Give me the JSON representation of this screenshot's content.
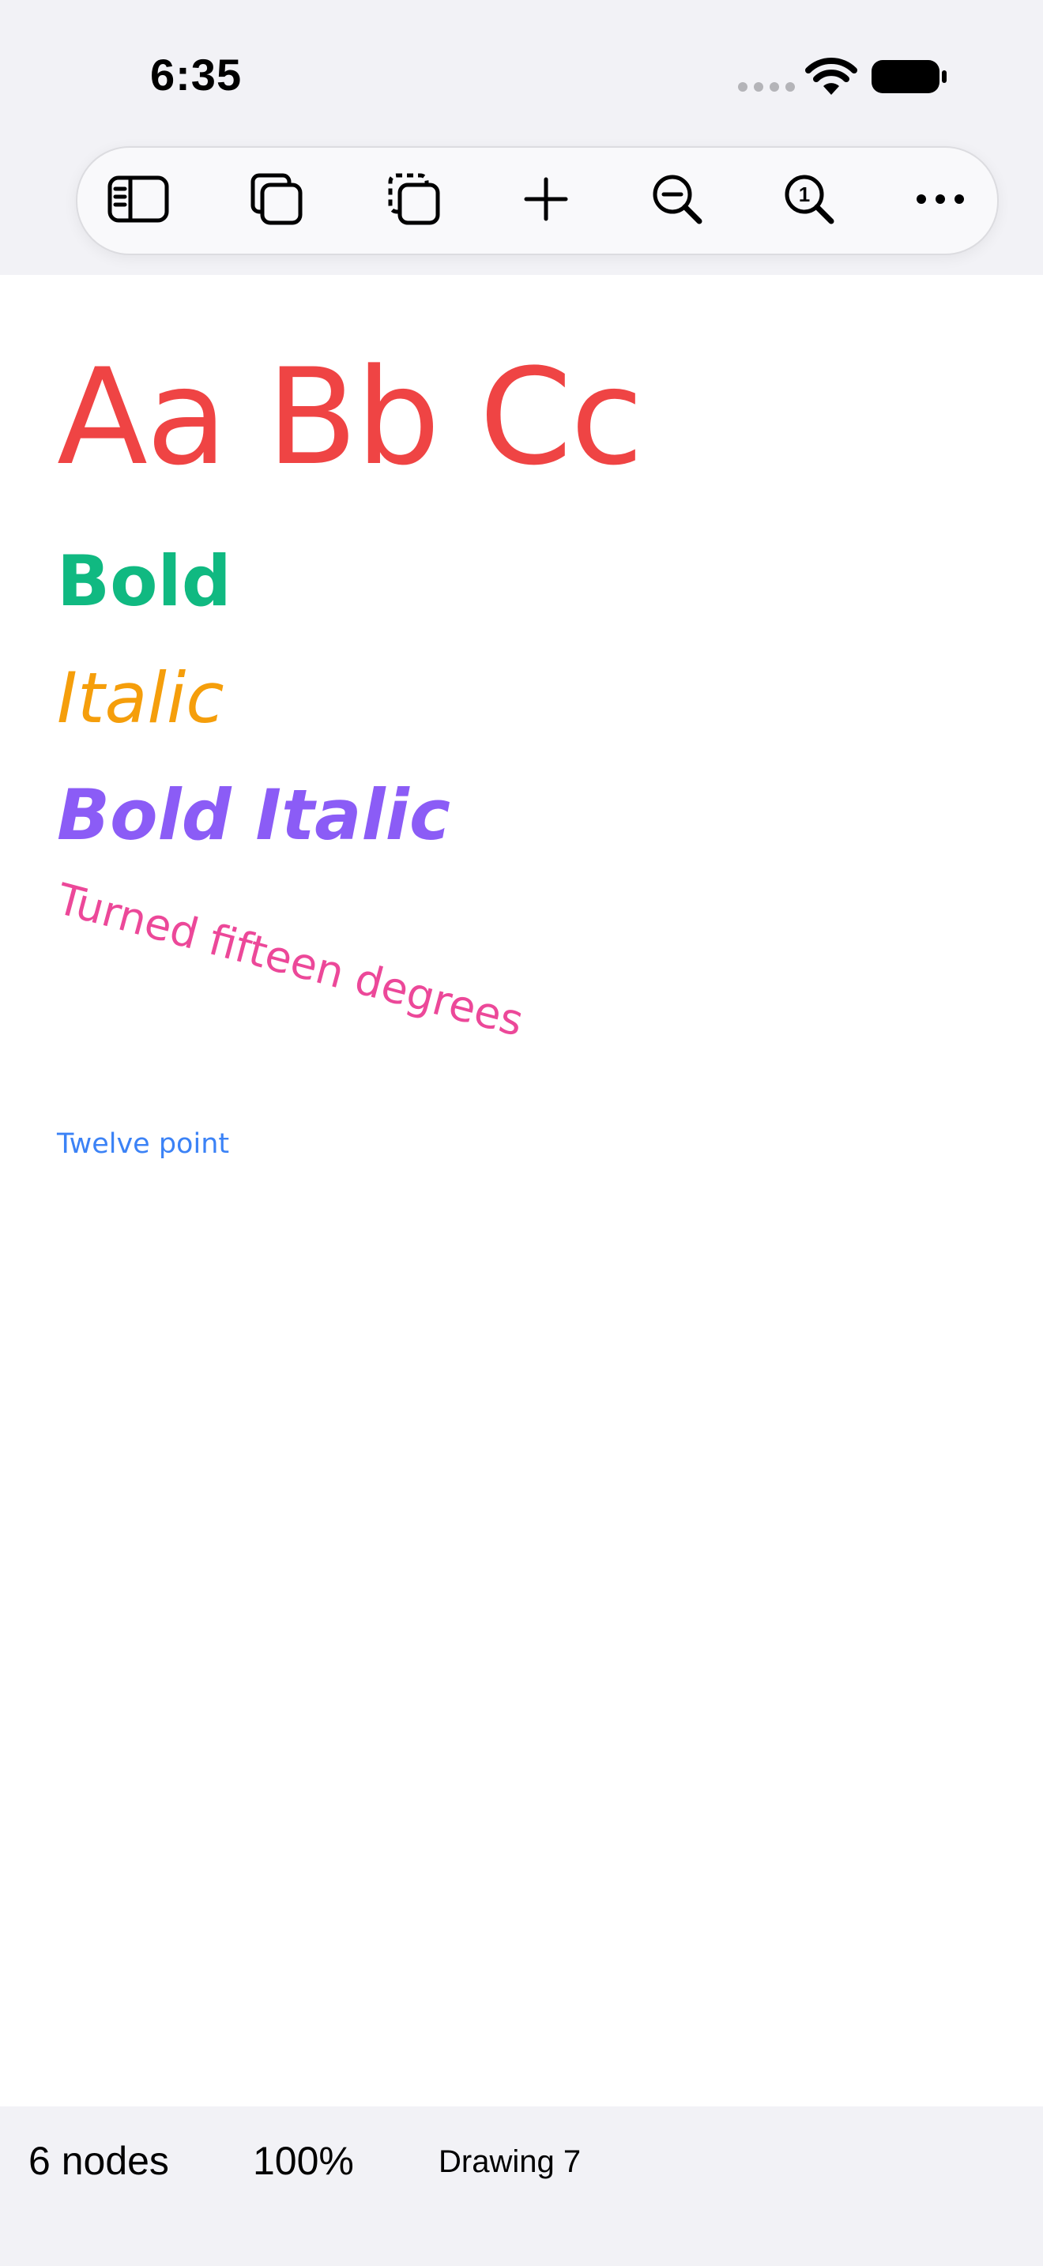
{
  "status_bar": {
    "time": "6:35",
    "icons": [
      "cellular-signal-icon",
      "wifi-icon",
      "battery-icon"
    ]
  },
  "toolbar": {
    "buttons": [
      {
        "name": "toggle-sidebar",
        "icon": "sidebar-icon"
      },
      {
        "name": "duplicate",
        "icon": "duplicate-icon"
      },
      {
        "name": "select-copy",
        "icon": "dashed-copy-icon"
      },
      {
        "name": "add",
        "icon": "plus-icon"
      },
      {
        "name": "zoom-out",
        "icon": "zoom-out-icon"
      },
      {
        "name": "actual-size",
        "icon": "zoom-actual-size-icon"
      },
      {
        "name": "more",
        "icon": "ellipsis-icon"
      }
    ],
    "actual_size_glyph": "1"
  },
  "canvas": {
    "samples": [
      {
        "text": "Aa Bb Cc",
        "color": "#ef4444"
      },
      {
        "text": "Bold",
        "color": "#10b981"
      },
      {
        "text": "Italic",
        "color": "#f59e0b"
      },
      {
        "text": "Bold Italic",
        "color": "#8b5cf6"
      },
      {
        "text": "Turned fifteen degrees",
        "color": "#ec4899"
      },
      {
        "text": "Twelve point",
        "color": "#3b82f6"
      }
    ]
  },
  "bottom_bar": {
    "node_count": "6 nodes",
    "zoom": "100%",
    "document_name": "Drawing 7"
  }
}
